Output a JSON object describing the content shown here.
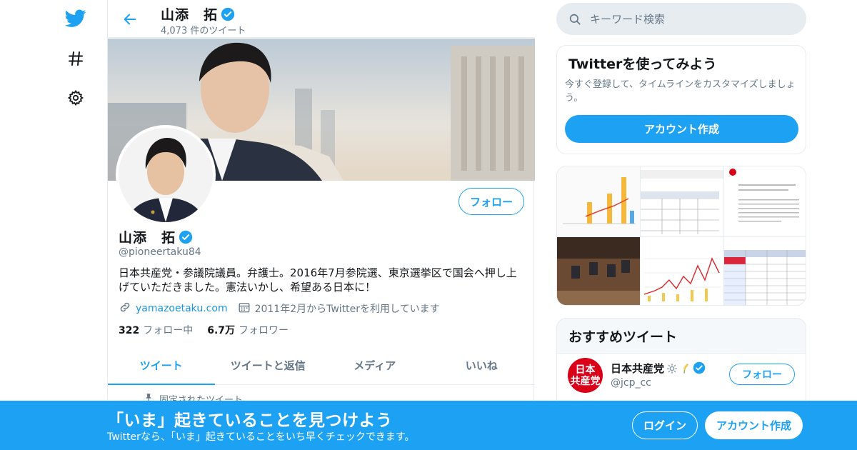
{
  "profile": {
    "name": "山添　拓",
    "tweet_count": "4,073 件のツイート",
    "handle": "@pioneertaku84",
    "bio": "日本共産党・参議院議員。弁護士。2016年7月参院選、東京選挙区で国会へ押し上げていただきました。憲法いかし、希望ある日本に！",
    "url": "yamazoetaku.com",
    "joined": "2011年2月からTwitterを利用しています",
    "following_count": "322",
    "following_label": "フォロー中",
    "followers_count": "6.7万",
    "followers_label": "フォロワー",
    "follow_button": "フォロー"
  },
  "tabs": [
    {
      "label": "ツイート",
      "active": true
    },
    {
      "label": "ツイートと返信",
      "active": false
    },
    {
      "label": "メディア",
      "active": false
    },
    {
      "label": "いいね",
      "active": false
    }
  ],
  "pinned_label": "固定されたツイート",
  "search": {
    "placeholder": "キーワード検索"
  },
  "signup_card": {
    "title": "Twitterを使ってみよう",
    "description": "今すぐ登録して、タイムラインをカスタマイズしましょう。",
    "button": "アカウント作成"
  },
  "recommended": {
    "title": "おすすめツイート",
    "account_name": "日本共産党",
    "account_handle": "@jcp_cc",
    "logo_text": "日本\n共産党",
    "follow_button": "フォロー"
  },
  "bottom_bar": {
    "title": "「いま」起きていることを見つけよう",
    "subtitle": "Twitterなら、「いま」起きていることをいち早くチェックできます。",
    "login": "ログイン",
    "signup": "アカウント作成"
  },
  "colors": {
    "accent": "#1da1f2",
    "verified": "#1da1f2",
    "jcp_red": "#d90018"
  }
}
